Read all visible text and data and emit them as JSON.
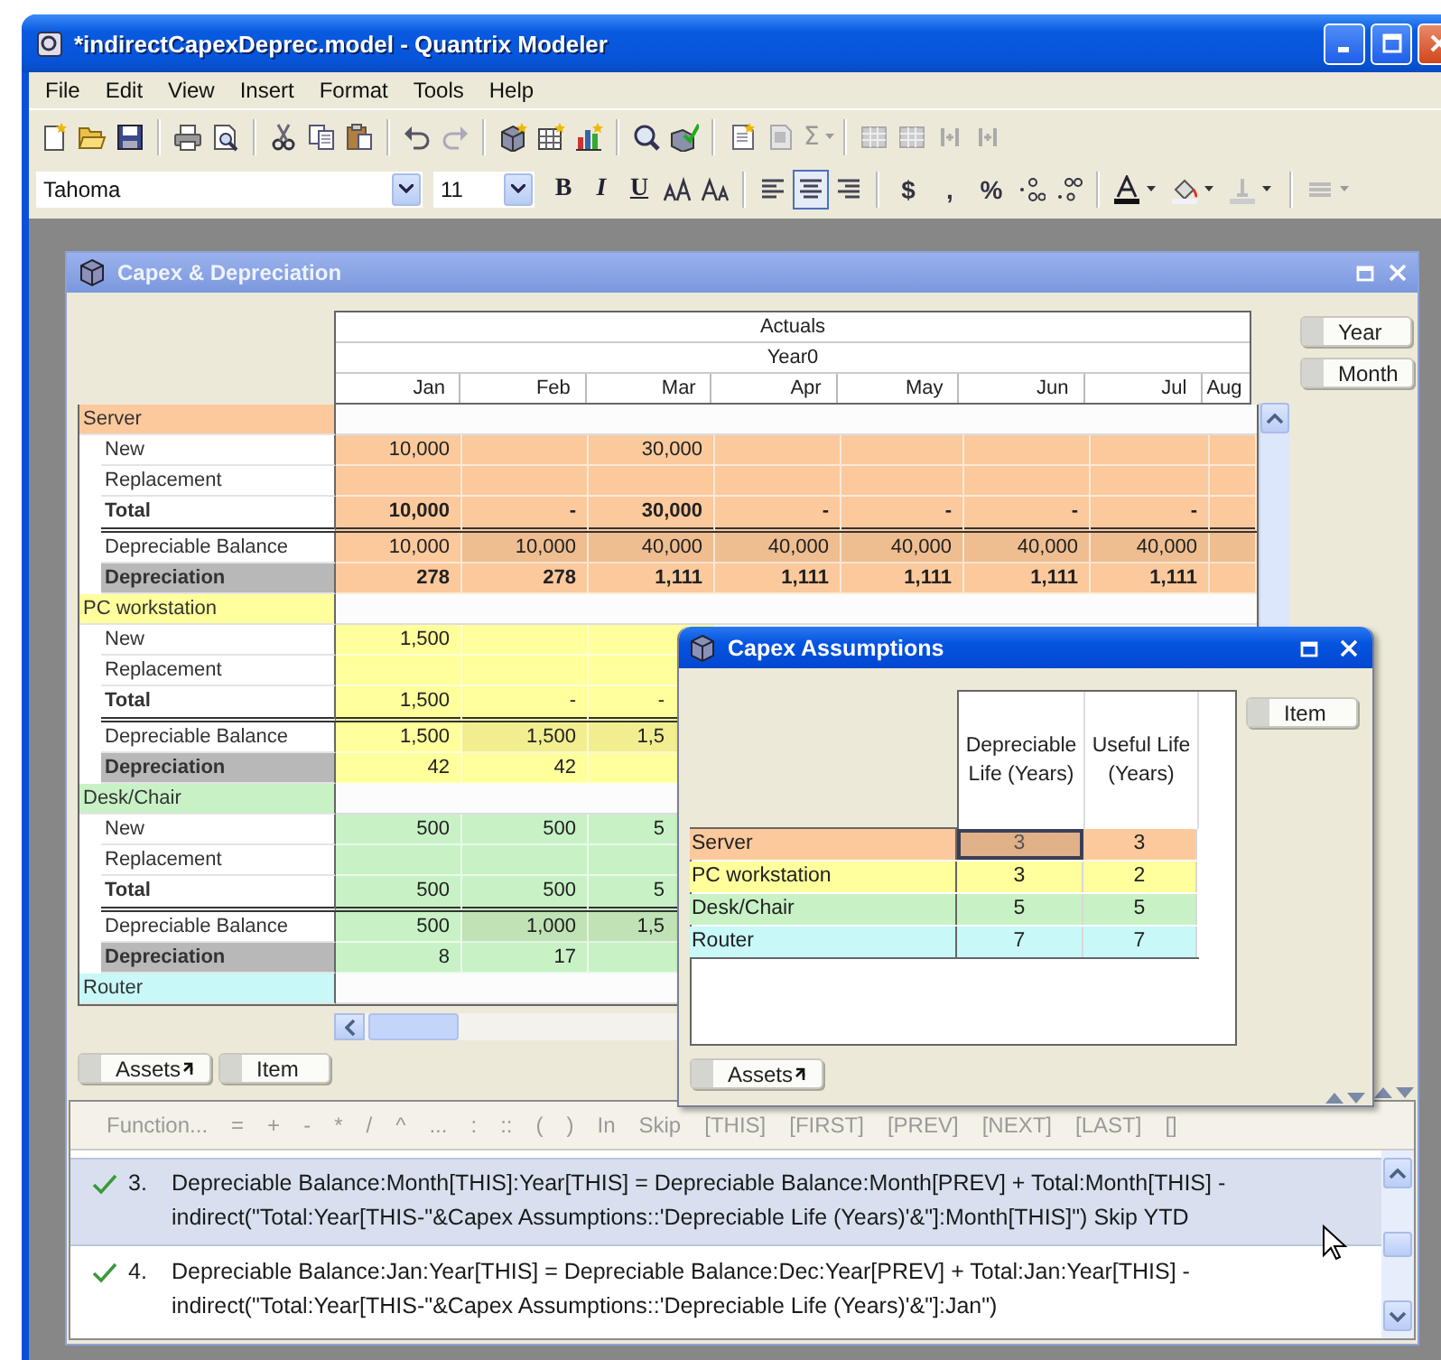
{
  "window": {
    "title": "*indirectCapexDeprec.model - Quantrix Modeler"
  },
  "menu": [
    "File",
    "Edit",
    "View",
    "Insert",
    "Format",
    "Tools",
    "Help"
  ],
  "standard_toolbar": {
    "sum": "Σ"
  },
  "format_toolbar": {
    "font": "Tahoma",
    "size": "11",
    "bold": "B",
    "italic": "I",
    "underline": "U",
    "alignment": [
      {
        "selected": false
      },
      {
        "selected": true
      },
      {
        "selected": false
      }
    ],
    "currency": "$",
    "comma": ",",
    "percent": "%"
  },
  "main_view": {
    "title": "Capex & Depreciation",
    "header": "Actuals",
    "year": "Year0",
    "months": [
      "Jan",
      "Feb",
      "Mar",
      "Apr",
      "May",
      "Jun",
      "Jul",
      "Aug"
    ],
    "groups": [
      {
        "name": "Server",
        "color": "#fcc99c",
        "rows": [
          {
            "kind": "new",
            "label": "New",
            "bold": false,
            "values": [
              {
                "kind": "number",
                "text": "10,000"
              },
              {
                "kind": "blank"
              },
              {
                "kind": "number",
                "text": "30,000"
              },
              {
                "kind": "blank"
              },
              {
                "kind": "blank"
              },
              {
                "kind": "blank"
              },
              {
                "kind": "blank"
              }
            ]
          },
          {
            "kind": "replacement",
            "label": "Replacement",
            "bold": false,
            "values": [
              {
                "kind": "blank"
              },
              {
                "kind": "blank"
              },
              {
                "kind": "blank"
              },
              {
                "kind": "blank"
              },
              {
                "kind": "blank"
              },
              {
                "kind": "blank"
              },
              {
                "kind": "blank"
              }
            ]
          },
          {
            "kind": "total",
            "label": "Total",
            "bold": true,
            "values": [
              {
                "kind": "number",
                "text": "10,000"
              },
              {
                "kind": "number",
                "text": "-"
              },
              {
                "kind": "number",
                "text": "30,000"
              },
              {
                "kind": "number",
                "text": "-"
              },
              {
                "kind": "number",
                "text": "-"
              },
              {
                "kind": "number",
                "text": "-"
              },
              {
                "kind": "number",
                "text": "-"
              }
            ]
          },
          {
            "kind": "balance",
            "label": "Depreciable Balance",
            "bold": false,
            "values": [
              {
                "kind": "number",
                "text": "10,000"
              },
              {
                "kind": "number",
                "text": "10,000"
              },
              {
                "kind": "number",
                "text": "40,000"
              },
              {
                "kind": "number",
                "text": "40,000"
              },
              {
                "kind": "number",
                "text": "40,000"
              },
              {
                "kind": "number",
                "text": "40,000"
              },
              {
                "kind": "number",
                "text": "40,000"
              }
            ]
          },
          {
            "kind": "depreciation",
            "label": "Depreciation",
            "bold": true,
            "values": [
              {
                "kind": "number",
                "text": "278"
              },
              {
                "kind": "number",
                "text": "278"
              },
              {
                "kind": "number",
                "text": "1,111"
              },
              {
                "kind": "number",
                "text": "1,111"
              },
              {
                "kind": "number",
                "text": "1,111"
              },
              {
                "kind": "number",
                "text": "1,111"
              },
              {
                "kind": "number",
                "text": "1,111"
              }
            ]
          }
        ]
      },
      {
        "name": "PC workstation",
        "color": "#ffff9c",
        "rows": [
          {
            "kind": "new",
            "label": "New",
            "bold": false,
            "values": [
              {
                "kind": "number",
                "text": "1,500"
              },
              {
                "kind": "blank"
              },
              {
                "kind": "blank"
              }
            ]
          },
          {
            "kind": "replacement",
            "label": "Replacement",
            "bold": false,
            "values": [
              {
                "kind": "blank"
              },
              {
                "kind": "blank"
              },
              {
                "kind": "blank"
              }
            ]
          },
          {
            "kind": "total",
            "label": "Total",
            "bold": false,
            "values": [
              {
                "kind": "number",
                "text": "1,500"
              },
              {
                "kind": "number",
                "text": "-"
              },
              {
                "kind": "number",
                "text": "-"
              }
            ]
          },
          {
            "kind": "balance",
            "label": "Depreciable Balance",
            "bold": false,
            "values": [
              {
                "kind": "number",
                "text": "1,500"
              },
              {
                "kind": "number",
                "text": "1,500"
              },
              {
                "kind": "number",
                "text": "1,5"
              }
            ]
          },
          {
            "kind": "depreciation",
            "label": "Depreciation",
            "bold": false,
            "values": [
              {
                "kind": "number",
                "text": "42"
              },
              {
                "kind": "number",
                "text": "42"
              },
              {
                "kind": "blank"
              }
            ]
          }
        ]
      },
      {
        "name": "Desk/Chair",
        "color": "#c8f2c6",
        "rows": [
          {
            "kind": "new",
            "label": "New",
            "bold": false,
            "values": [
              {
                "kind": "number",
                "text": "500"
              },
              {
                "kind": "number",
                "text": "500"
              },
              {
                "kind": "number",
                "text": "5"
              }
            ]
          },
          {
            "kind": "replacement",
            "label": "Replacement",
            "bold": false,
            "values": [
              {
                "kind": "blank"
              },
              {
                "kind": "blank"
              },
              {
                "kind": "blank"
              }
            ]
          },
          {
            "kind": "total",
            "label": "Total",
            "bold": false,
            "values": [
              {
                "kind": "number",
                "text": "500"
              },
              {
                "kind": "number",
                "text": "500"
              },
              {
                "kind": "number",
                "text": "5"
              }
            ]
          },
          {
            "kind": "balance",
            "label": "Depreciable Balance",
            "bold": false,
            "values": [
              {
                "kind": "number",
                "text": "500"
              },
              {
                "kind": "number",
                "text": "1,000"
              },
              {
                "kind": "number",
                "text": "1,5"
              }
            ]
          },
          {
            "kind": "depreciation",
            "label": "Depreciation",
            "bold": false,
            "values": [
              {
                "kind": "number",
                "text": "8"
              },
              {
                "kind": "number",
                "text": "17"
              },
              {
                "kind": "blank"
              }
            ]
          }
        ]
      },
      {
        "name": "Router",
        "color": "#c8f8f8"
      }
    ],
    "side_tiles": [
      {
        "label": "Year"
      },
      {
        "label": "Month"
      }
    ],
    "bottom_tiles": [
      {
        "label": "Assets",
        "kind": "nested"
      },
      {
        "label": "Item",
        "kind": "plain"
      }
    ]
  },
  "assumptions_view": {
    "title": "Capex Assumptions",
    "columns": [
      "Depreciable Life (Years)",
      "Useful Life (Years)"
    ],
    "rows": [
      {
        "label": "Server",
        "color": "#fcc99c",
        "values": [
          {
            "text": "3",
            "selected": true
          },
          {
            "text": "3",
            "selected": false
          }
        ]
      },
      {
        "label": "PC workstation",
        "color": "#ffff9c",
        "values": [
          {
            "text": "3",
            "selected": false
          },
          {
            "text": "2",
            "selected": false
          }
        ]
      },
      {
        "label": "Desk/Chair",
        "color": "#c8f2c6",
        "values": [
          {
            "text": "5",
            "selected": false
          },
          {
            "text": "5",
            "selected": false
          }
        ]
      },
      {
        "label": "Router",
        "color": "#c8f8f8",
        "values": [
          {
            "text": "7",
            "selected": false
          },
          {
            "text": "7",
            "selected": false
          }
        ]
      }
    ],
    "side_tiles": [
      {
        "label": "Item"
      }
    ],
    "bottom_tiles": [
      {
        "label": "Assets",
        "kind": "nested"
      }
    ]
  },
  "formula_toolbar": [
    "Function...",
    "=",
    "+",
    "-",
    "*",
    "/",
    "^",
    "...",
    ":",
    "::",
    "(",
    ")",
    "In",
    "Skip",
    "[THIS]",
    "[FIRST]",
    "[PREV]",
    "[NEXT]",
    "[LAST]",
    "[]"
  ],
  "formulas": [
    {
      "number": "3.",
      "text": "Depreciable Balance:Month[THIS]:Year[THIS] = Depreciable Balance:Month[PREV] + Total:Month[THIS] - indirect(\"Total:Year[THIS-\"&Capex Assumptions::'Depreciable Life (Years)'&\"]:Month[THIS]\") Skip YTD",
      "valid": true,
      "selected": true
    },
    {
      "number": "4.",
      "text": "Depreciable Balance:Jan:Year[THIS] = Depreciable Balance:Dec:Year[PREV] + Total:Jan:Year[THIS] - indirect(\"Total:Year[THIS-\"&Capex Assumptions::'Depreciable Life (Years)'&\"]:Jan\")",
      "valid": true,
      "selected": false
    }
  ]
}
